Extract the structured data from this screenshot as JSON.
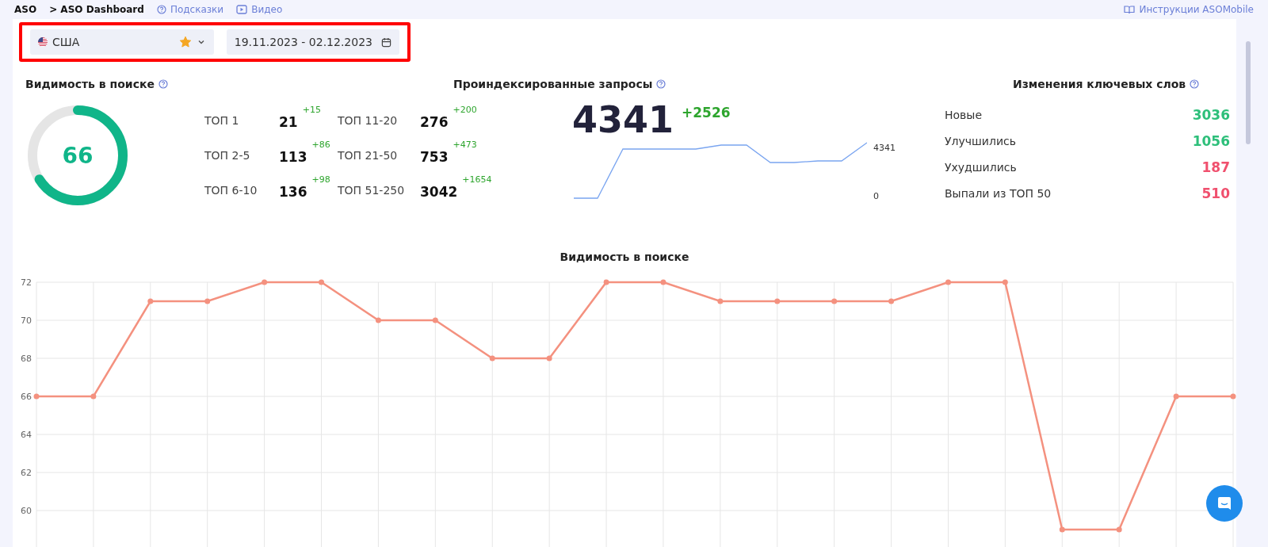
{
  "breadcrumbs": {
    "root": "ASO",
    "current": "> ASO Dashboard"
  },
  "header_links": [
    {
      "kind": "help",
      "label": "Подсказки"
    },
    {
      "kind": "video",
      "label": "Видео"
    }
  ],
  "instructions_link": "Инструкции ASOMobile",
  "filters": {
    "country": "США",
    "favorite": true,
    "date_range": "19.11.2023 - 02.12.2023"
  },
  "visibility": {
    "title": "Видимость в поиске",
    "score": "66",
    "level": 0.66,
    "tops": [
      {
        "label": "ТОП 1",
        "value": "21",
        "delta": "+15"
      },
      {
        "label": "ТОП 11-20",
        "value": "276",
        "delta": "+200"
      },
      {
        "label": "ТОП 2-5",
        "value": "113",
        "delta": "+86"
      },
      {
        "label": "ТОП 21-50",
        "value": "753",
        "delta": "+473"
      },
      {
        "label": "ТОП 6-10",
        "value": "136",
        "delta": "+98"
      },
      {
        "label": "ТОП 51-250",
        "value": "3042",
        "delta": "+1654"
      }
    ]
  },
  "indexed": {
    "title": "Проиндексированные запросы",
    "total": "4341",
    "delta": "+2526",
    "max_label": "4341",
    "min_label": "0"
  },
  "keyword_changes": {
    "title": "Изменения ключевых слов",
    "items": [
      {
        "label": "Новые",
        "value": "3036",
        "color": "#2dbf7a"
      },
      {
        "label": "Улучшились",
        "value": "1056",
        "color": "#2dbf7a"
      },
      {
        "label": "Ухудшились",
        "value": "187",
        "color": "#f0506e"
      },
      {
        "label": "Выпали из ТОП 50",
        "value": "510",
        "color": "#f0506e"
      }
    ]
  },
  "visibility_chart": {
    "chart_data": {
      "type": "line",
      "title": "Видимость в поиске",
      "ylim": [
        58,
        72
      ],
      "yticks": [
        60,
        62,
        64,
        66,
        68,
        70,
        72
      ],
      "grid": true,
      "series": [
        {
          "color": "#f4917f",
          "marker": "o",
          "values": [
            66,
            66,
            71,
            71,
            72,
            72,
            70,
            70,
            68,
            68,
            72,
            72,
            71,
            71,
            71,
            71,
            72,
            72,
            59,
            59,
            66,
            66
          ]
        }
      ]
    }
  }
}
